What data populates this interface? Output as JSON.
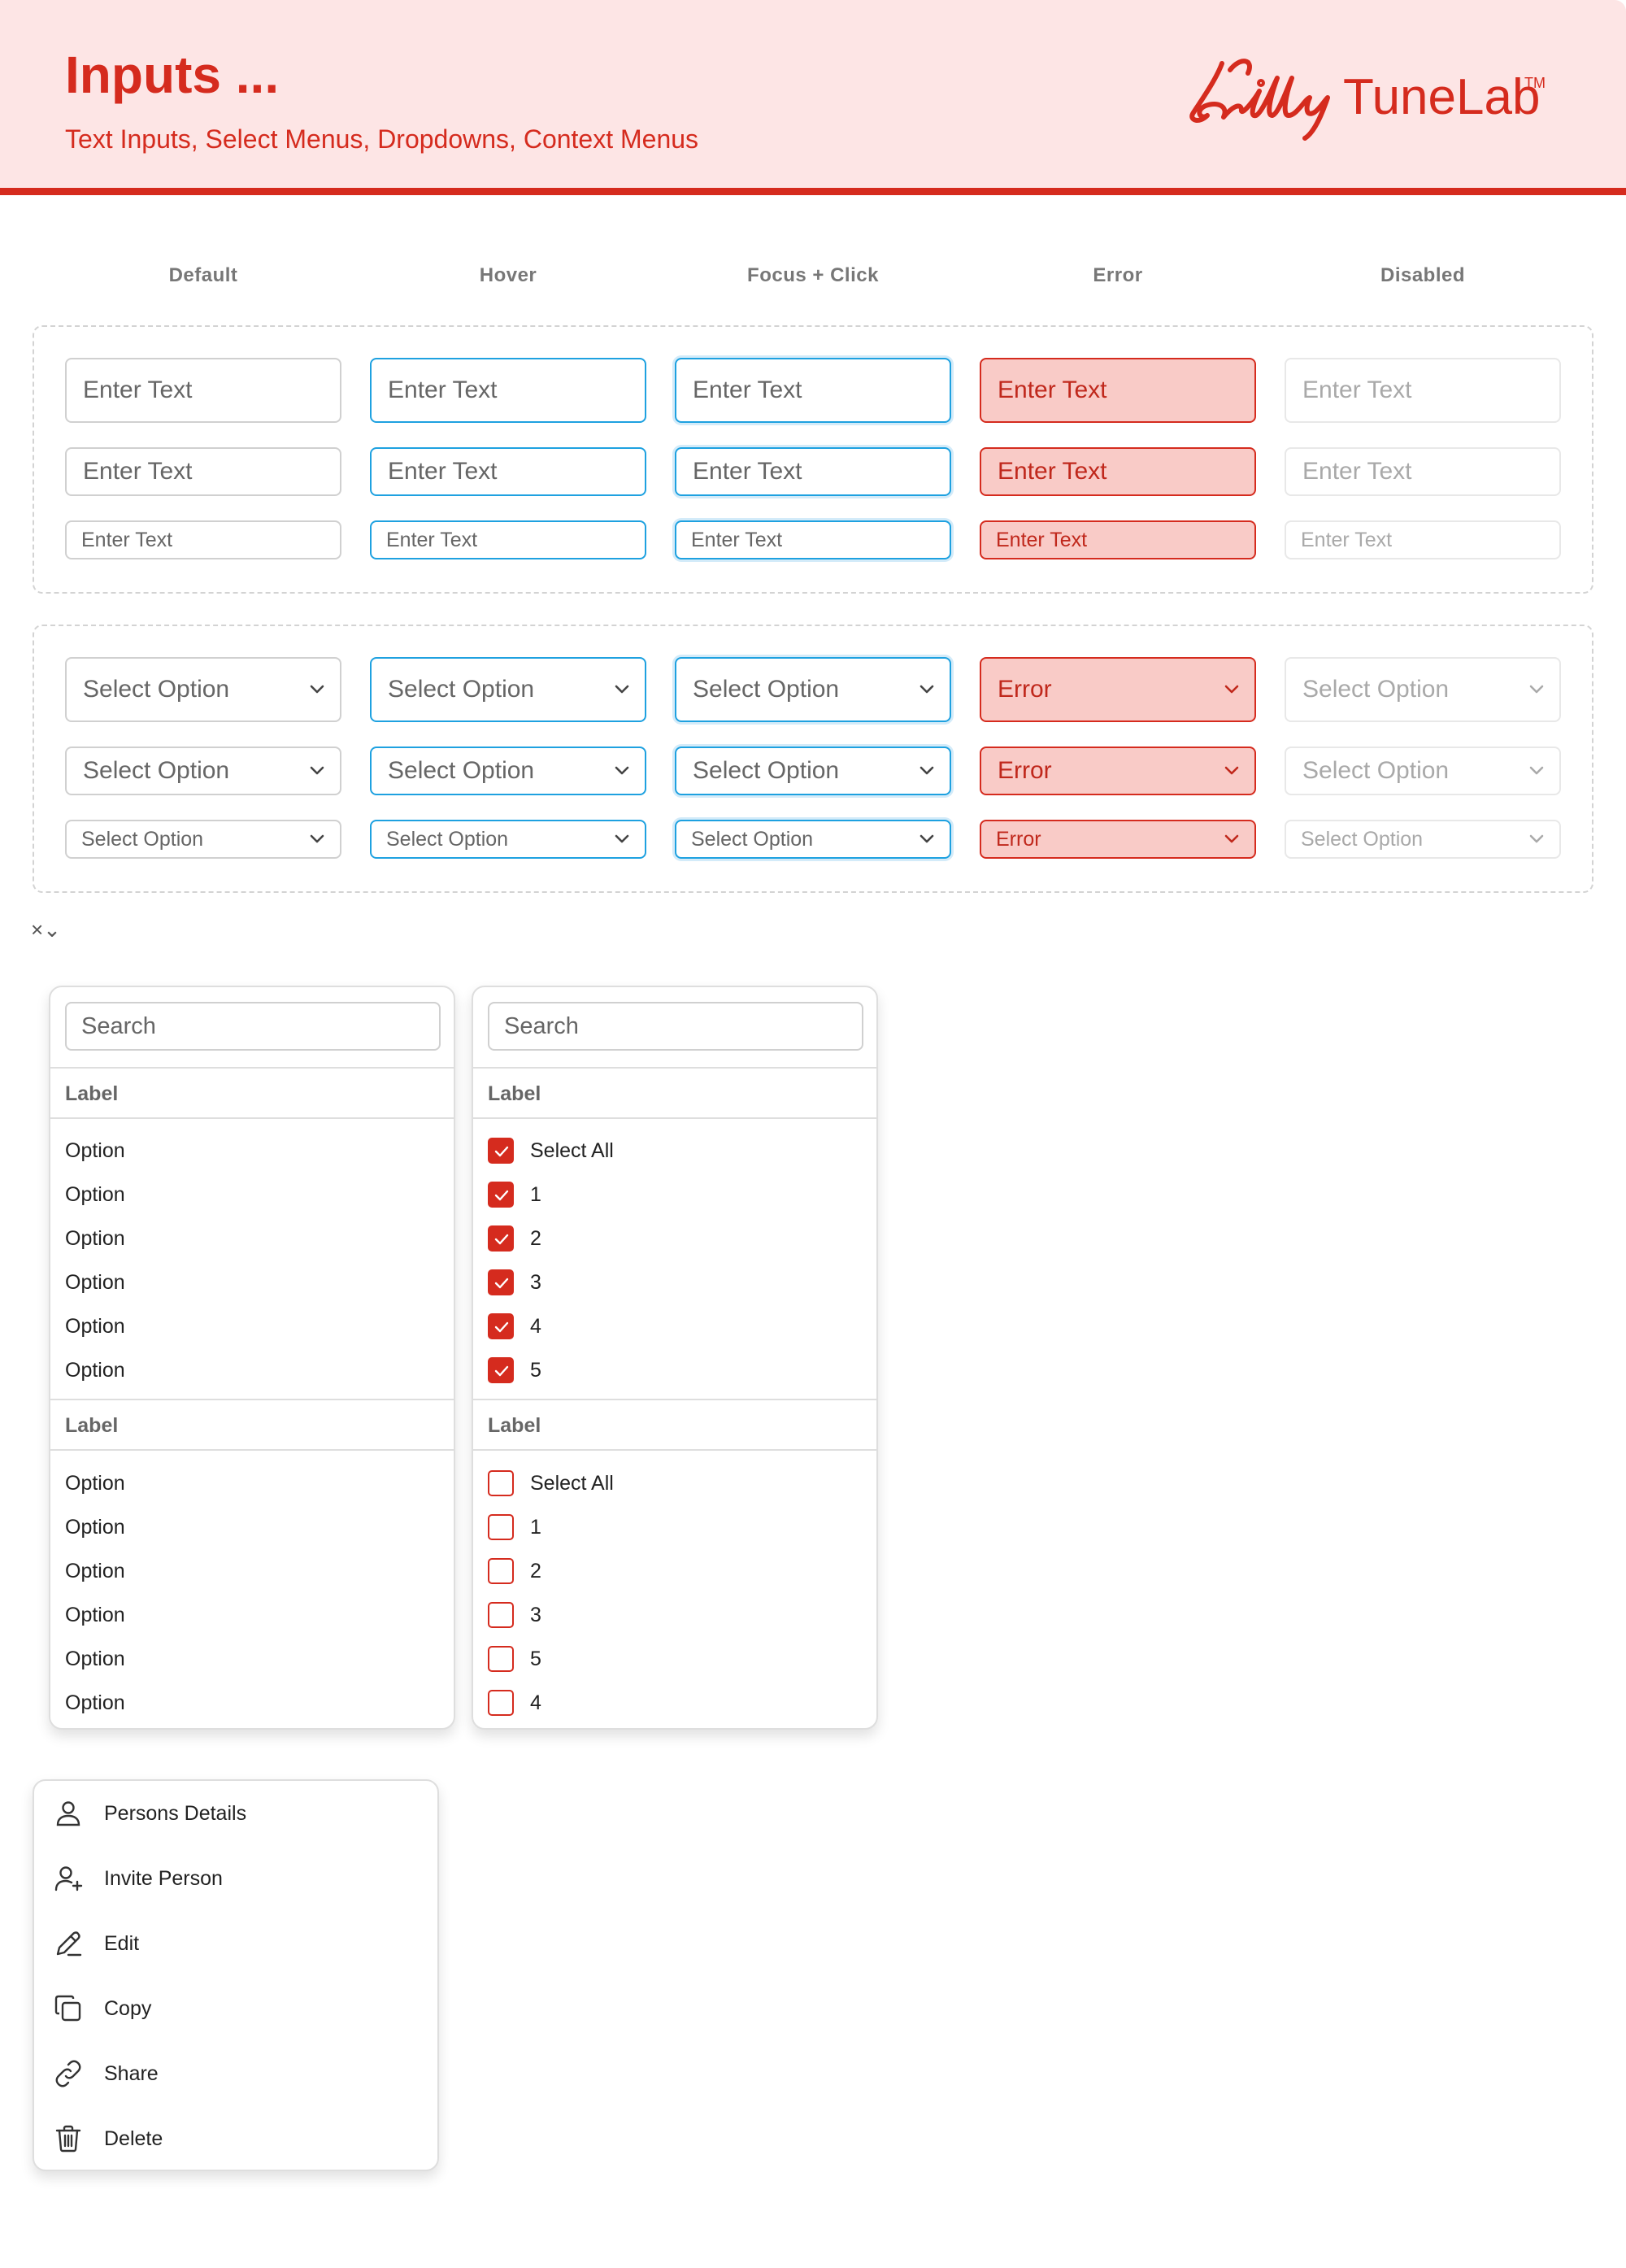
{
  "header": {
    "title": "Inputs ...",
    "subtitle": "Text Inputs, Select Menus, Dropdowns, Context Menus",
    "brand_script": "Lilly",
    "brand_name": "TuneLab",
    "brand_tm": "TM"
  },
  "columns": [
    "Default",
    "Hover",
    "Focus + Click",
    "Error",
    "Disabled"
  ],
  "text_inputs": {
    "placeholder": "Enter Text",
    "error_value": "Enter Text"
  },
  "selects": {
    "placeholder": "Select Option",
    "error_value": "Error"
  },
  "floating_controls": "×⌄",
  "menu_single": {
    "search_placeholder": "Search",
    "groups": [
      {
        "label": "Label",
        "options": [
          "Option",
          "Option",
          "Option",
          "Option",
          "Option",
          "Option"
        ]
      },
      {
        "label": "Label",
        "options": [
          "Option",
          "Option",
          "Option",
          "Option",
          "Option",
          "Option"
        ]
      }
    ]
  },
  "menu_multi": {
    "search_placeholder": "Search",
    "groups": [
      {
        "label": "Label",
        "options": [
          {
            "text": "Select All",
            "checked": true
          },
          {
            "text": "1",
            "checked": true
          },
          {
            "text": "2",
            "checked": true
          },
          {
            "text": "3",
            "checked": true
          },
          {
            "text": "4",
            "checked": true
          },
          {
            "text": "5",
            "checked": true
          }
        ]
      },
      {
        "label": "Label",
        "options": [
          {
            "text": "Select All",
            "checked": false
          },
          {
            "text": "1",
            "checked": false
          },
          {
            "text": "2",
            "checked": false
          },
          {
            "text": "3",
            "checked": false
          },
          {
            "text": "5",
            "checked": false
          },
          {
            "text": "4",
            "checked": false
          }
        ]
      }
    ]
  },
  "context_menu": {
    "items": [
      {
        "label": "Persons Details",
        "icon": "person-icon"
      },
      {
        "label": "Invite Person",
        "icon": "person-add-icon"
      },
      {
        "label": "Edit",
        "icon": "pencil-icon"
      },
      {
        "label": "Copy",
        "icon": "copy-icon"
      },
      {
        "label": "Share",
        "icon": "link-icon"
      },
      {
        "label": "Delete",
        "icon": "trash-icon"
      }
    ]
  },
  "colors": {
    "brand": "#d52b1e",
    "header_bg": "#fde5e5",
    "focus_blue": "#1ea1e0",
    "error_bg": "#f9cbc7",
    "border": "#d0d0d0",
    "disabled_text": "#a9a9a9"
  }
}
